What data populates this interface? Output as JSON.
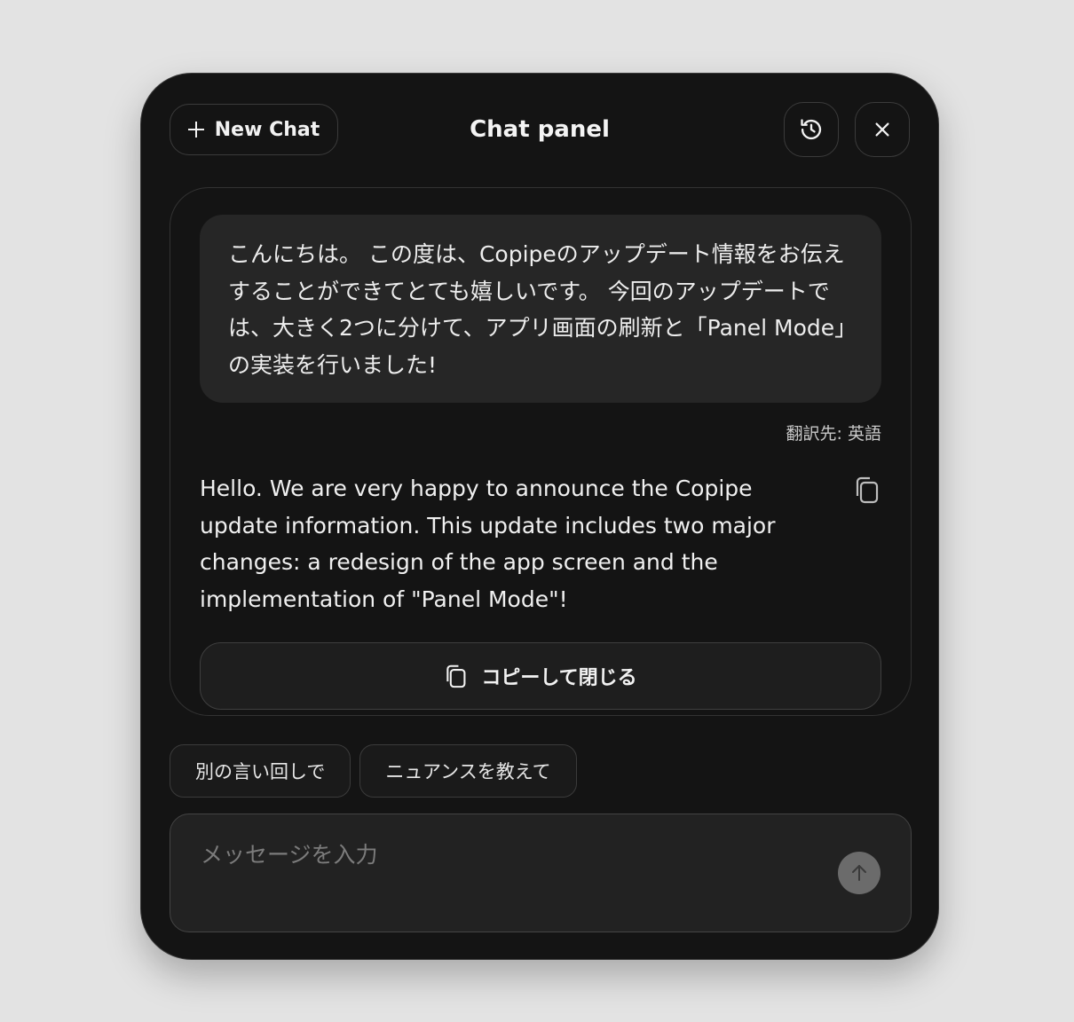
{
  "header": {
    "new_chat_label": "New Chat",
    "title": "Chat panel"
  },
  "conversation": {
    "source_text": "こんにちは。 この度は、Copipeのアップデート情報をお伝えすることができてとても嬉しいです。 今回のアップデートでは、大きく2つに分けて、アプリ画面の刷新と「Panel Mode」の実装を行いました!",
    "translate_label": "翻訳先: 英語",
    "result_text": "Hello. We are very happy to announce the Copipe update information. This update includes two major changes: a redesign of the app screen and the implementation of \"Panel Mode\"!",
    "copy_close_label": "コピーして閉じる"
  },
  "suggestions": [
    {
      "label": "別の言い回しで"
    },
    {
      "label": "ニュアンスを教えて"
    }
  ],
  "input": {
    "placeholder": "メッセージを入力",
    "value": ""
  },
  "icons": {
    "new_chat": "plus-icon",
    "history": "history-icon",
    "close": "close-icon",
    "copy": "copy-icon",
    "send": "arrow-up-icon"
  },
  "colors": {
    "panel_bg": "#141414",
    "bubble_bg": "#262626",
    "send_button": "#6b6b6b"
  }
}
